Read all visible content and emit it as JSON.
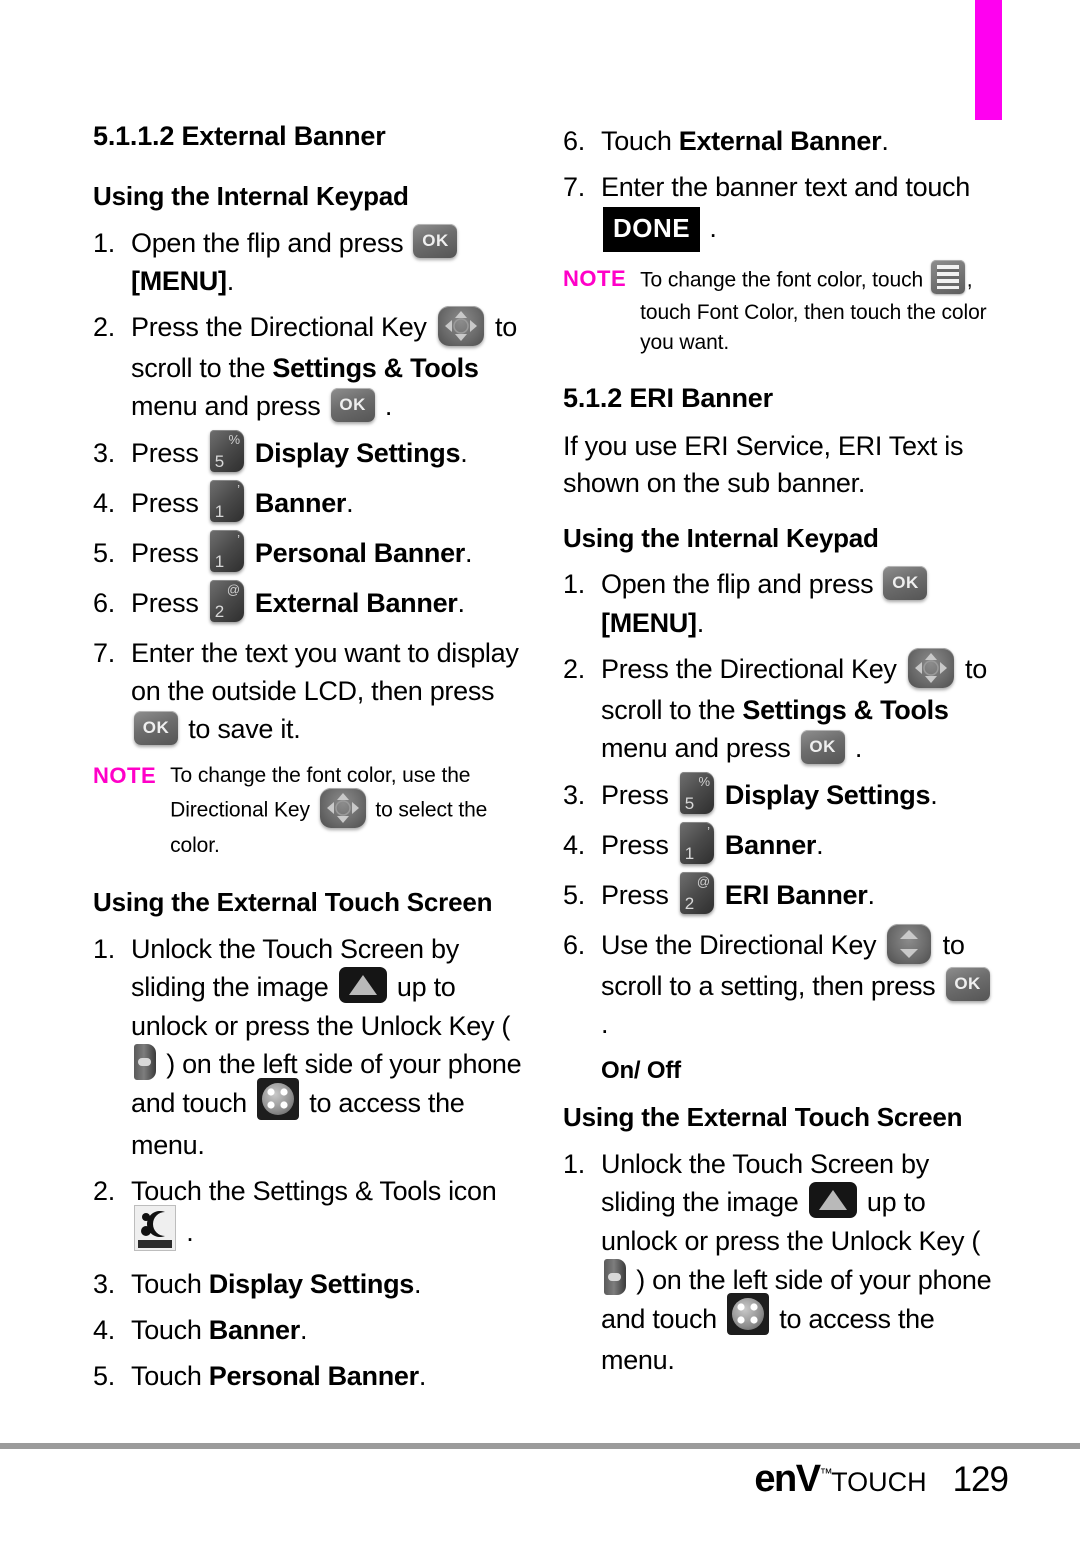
{
  "document": {
    "page_number": "129",
    "logo_main": "enV",
    "logo_tm": "™",
    "logo_sub": "TOUCH",
    "tab_color": "#ff00f0",
    "note_color": "#ff00c8"
  },
  "left_column": {
    "section_title": "5.1.1.2 External Banner",
    "internal_keypad_heading": "Using the Internal Keypad",
    "internal_steps": [
      {
        "num": "1.",
        "parts": [
          {
            "t": "text",
            "v": "Open the flip and press "
          },
          {
            "t": "icon",
            "v": "ok-key"
          },
          {
            "t": "bold",
            "v": " [MENU]"
          },
          {
            "t": "text",
            "v": "."
          }
        ]
      },
      {
        "num": "2.",
        "parts": [
          {
            "t": "text",
            "v": "Press the Directional Key "
          },
          {
            "t": "icon",
            "v": "dpad-4way"
          },
          {
            "t": "text",
            "v": " to scroll to the "
          },
          {
            "t": "bold",
            "v": "Settings & Tools"
          },
          {
            "t": "text",
            "v": " menu and press "
          },
          {
            "t": "icon",
            "v": "ok-key"
          },
          {
            "t": "text",
            "v": " ."
          }
        ]
      },
      {
        "num": "3.",
        "parts": [
          {
            "t": "text",
            "v": "Press "
          },
          {
            "t": "icon",
            "v": "key-5"
          },
          {
            "t": "bold",
            "v": " Display Settings"
          },
          {
            "t": "text",
            "v": "."
          }
        ]
      },
      {
        "num": "4.",
        "parts": [
          {
            "t": "text",
            "v": "Press "
          },
          {
            "t": "icon",
            "v": "key-1"
          },
          {
            "t": "bold",
            "v": " Banner"
          },
          {
            "t": "text",
            "v": "."
          }
        ]
      },
      {
        "num": "5.",
        "parts": [
          {
            "t": "text",
            "v": "Press "
          },
          {
            "t": "icon",
            "v": "key-1"
          },
          {
            "t": "bold",
            "v": " Personal Banner"
          },
          {
            "t": "text",
            "v": "."
          }
        ]
      },
      {
        "num": "6.",
        "parts": [
          {
            "t": "text",
            "v": "Press "
          },
          {
            "t": "icon",
            "v": "key-2"
          },
          {
            "t": "bold",
            "v": " External Banner"
          },
          {
            "t": "text",
            "v": "."
          }
        ]
      },
      {
        "num": "7.",
        "parts": [
          {
            "t": "text",
            "v": "Enter the text you want to display on the outside LCD, then press "
          },
          {
            "t": "icon",
            "v": "ok-key"
          },
          {
            "t": "text",
            "v": " to save it."
          }
        ]
      }
    ],
    "note": {
      "label": "NOTE",
      "parts": [
        {
          "t": "text",
          "v": "To change the font color, use the Directional Key "
        },
        {
          "t": "icon",
          "v": "dpad-4way"
        },
        {
          "t": "text",
          "v": " to select the color."
        }
      ]
    },
    "touch_screen_heading": "Using the External Touch Screen",
    "touch_steps": [
      {
        "num": "1.",
        "parts": [
          {
            "t": "text",
            "v": "Unlock the Touch Screen by sliding the image "
          },
          {
            "t": "icon",
            "v": "unlock-slider"
          },
          {
            "t": "text",
            "v": " up to unlock or press the Unlock Key ( "
          },
          {
            "t": "icon",
            "v": "unlock-key"
          },
          {
            "t": "text",
            "v": " ) on the left side of your phone and touch "
          },
          {
            "t": "icon",
            "v": "menu-4dot"
          },
          {
            "t": "text",
            "v": " to access the menu."
          }
        ]
      },
      {
        "num": "2.",
        "parts": [
          {
            "t": "text",
            "v": "Touch the Settings & Tools icon "
          },
          {
            "t": "icon",
            "v": "settings-tools"
          },
          {
            "t": "text",
            "v": " ."
          }
        ]
      },
      {
        "num": "3.",
        "parts": [
          {
            "t": "text",
            "v": "Touch "
          },
          {
            "t": "bold",
            "v": "Display Settings"
          },
          {
            "t": "text",
            "v": "."
          }
        ]
      },
      {
        "num": "4.",
        "parts": [
          {
            "t": "text",
            "v": "Touch "
          },
          {
            "t": "bold",
            "v": "Banner"
          },
          {
            "t": "text",
            "v": "."
          }
        ]
      },
      {
        "num": "5.",
        "parts": [
          {
            "t": "text",
            "v": "Touch "
          },
          {
            "t": "bold",
            "v": "Personal Banner"
          },
          {
            "t": "text",
            "v": "."
          }
        ]
      }
    ]
  },
  "right_column": {
    "continued_steps": [
      {
        "num": "6.",
        "parts": [
          {
            "t": "text",
            "v": "Touch "
          },
          {
            "t": "bold",
            "v": "External Banner"
          },
          {
            "t": "text",
            "v": "."
          }
        ]
      },
      {
        "num": "7.",
        "parts": [
          {
            "t": "text",
            "v": "Enter the banner text and touch "
          },
          {
            "t": "badge",
            "v": "DONE"
          },
          {
            "t": "text",
            "v": " ."
          }
        ]
      }
    ],
    "note": {
      "label": "NOTE",
      "parts": [
        {
          "t": "text",
          "v": "To change the font color, touch "
        },
        {
          "t": "icon",
          "v": "font-color-list"
        },
        {
          "t": "text",
          "v": ", touch Font Color, then touch the color you want."
        }
      ]
    },
    "eri_section_title": "5.1.2 ERI Banner",
    "eri_description": "If you use ERI Service, ERI Text is shown on the sub banner.",
    "internal_keypad_heading": "Using the Internal Keypad",
    "eri_steps": [
      {
        "num": "1.",
        "parts": [
          {
            "t": "text",
            "v": "Open the flip and press "
          },
          {
            "t": "icon",
            "v": "ok-key"
          },
          {
            "t": "bold",
            "v": " [MENU]"
          },
          {
            "t": "text",
            "v": "."
          }
        ]
      },
      {
        "num": "2.",
        "parts": [
          {
            "t": "text",
            "v": "Press the Directional Key "
          },
          {
            "t": "icon",
            "v": "dpad-4way"
          },
          {
            "t": "text",
            "v": " to scroll to the "
          },
          {
            "t": "bold",
            "v": "Settings & Tools"
          },
          {
            "t": "text",
            "v": " menu and press "
          },
          {
            "t": "icon",
            "v": "ok-key"
          },
          {
            "t": "text",
            "v": " ."
          }
        ]
      },
      {
        "num": "3.",
        "parts": [
          {
            "t": "text",
            "v": "Press "
          },
          {
            "t": "icon",
            "v": "key-5"
          },
          {
            "t": "bold",
            "v": " Display Settings"
          },
          {
            "t": "text",
            "v": "."
          }
        ]
      },
      {
        "num": "4.",
        "parts": [
          {
            "t": "text",
            "v": "Press "
          },
          {
            "t": "icon",
            "v": "key-1"
          },
          {
            "t": "bold",
            "v": " Banner"
          },
          {
            "t": "text",
            "v": "."
          }
        ]
      },
      {
        "num": "5.",
        "parts": [
          {
            "t": "text",
            "v": "Press "
          },
          {
            "t": "icon",
            "v": "key-2"
          },
          {
            "t": "bold",
            "v": " ERI Banner"
          },
          {
            "t": "text",
            "v": "."
          }
        ]
      },
      {
        "num": "6.",
        "parts": [
          {
            "t": "text",
            "v": "Use the Directional Key "
          },
          {
            "t": "icon",
            "v": "dpad-updown"
          },
          {
            "t": "text",
            "v": " to scroll to a setting, then press "
          },
          {
            "t": "icon",
            "v": "ok-key"
          },
          {
            "t": "text",
            "v": " ."
          }
        ]
      }
    ],
    "onoff_heading": "On/ Off",
    "touch_screen_heading": "Using the External Touch Screen",
    "onoff_touch_steps": [
      {
        "num": "1.",
        "parts": [
          {
            "t": "text",
            "v": "Unlock the Touch Screen by sliding the image "
          },
          {
            "t": "icon",
            "v": "unlock-slider"
          },
          {
            "t": "text",
            "v": " up to unlock or press the Unlock Key ( "
          },
          {
            "t": "icon",
            "v": "unlock-key"
          },
          {
            "t": "text",
            "v": " ) on the left side of your phone and touch "
          },
          {
            "t": "icon",
            "v": "menu-4dot"
          },
          {
            "t": "text",
            "v": " to access the menu."
          }
        ]
      }
    ]
  },
  "icons": {
    "ok-key": "OK",
    "key-5": {
      "digit": "5",
      "sym": "%"
    },
    "key-1": {
      "digit": "1",
      "sym": "’"
    },
    "key-2": {
      "digit": "2",
      "sym": "@"
    },
    "dpad-4way": "directional-key-4way-icon",
    "dpad-updown": "directional-key-updown-icon",
    "unlock-slider": "unlock-slider-triangle-icon",
    "unlock-key": "unlock-hardware-key-icon",
    "menu-4dot": "menu-four-dot-icon",
    "settings-tools": "settings-and-tools-app-icon",
    "font-color-list": "font-color-list-icon"
  }
}
